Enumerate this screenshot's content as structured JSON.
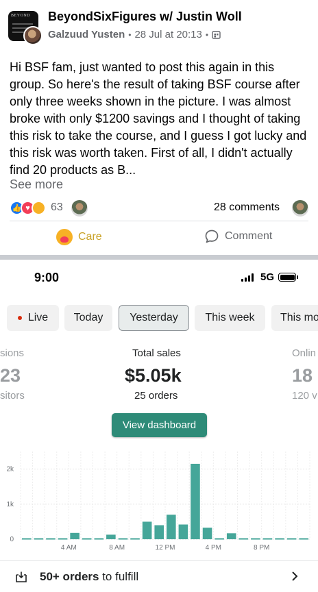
{
  "post": {
    "group_name": "BeyondSixFigures w/ Justin Woll",
    "author": "Galzuud Yusten",
    "date": "28 Jul at 20:13",
    "group_logo_text": "BEYOND",
    "body": "Hi BSF fam, just wanted to post this again in this group. So here's the result of taking BSF course after only three weeks shown in the picture. I was almost broke with only $1200 savings and I thought of taking this risk to take the course, and I guess I got lucky and this risk was worth taken. First of all, I didn't actually find 20 products as B...",
    "see_more": "See more",
    "reaction_count": "63",
    "comments": "28 comments",
    "actions": {
      "care": "Care",
      "comment": "Comment"
    },
    "icons": [
      "like-icon",
      "love-icon",
      "care-icon",
      "privacy-icon",
      "comment-icon"
    ]
  },
  "dashboard": {
    "status_time": "9:00",
    "network": "5G",
    "tabs": [
      "Live",
      "Today",
      "Yesterday",
      "This week",
      "This mo"
    ],
    "selected_tab": "Yesterday",
    "stats": {
      "left": {
        "label": "sions",
        "value": "23",
        "sub": "sitors"
      },
      "center": {
        "label": "Total sales",
        "value": "$5.05k",
        "sub": "25 orders"
      },
      "right": {
        "label": "Onlin",
        "value": "18",
        "sub": "120 v"
      }
    },
    "view_button": "View dashboard",
    "fulfill": {
      "count": "50+ orders",
      "suffix": " to fulfill"
    },
    "colors": {
      "accent": "#2e8b78",
      "bar": "#45a699",
      "live": "#d72c0d"
    }
  },
  "chart_data": {
    "type": "bar",
    "title": "",
    "xlabel": "",
    "ylabel": "",
    "ylim": [
      0,
      2500
    ],
    "yticks": [
      0,
      1000,
      2000
    ],
    "ytick_labels": [
      "0",
      "1k",
      "2k"
    ],
    "xtick_labels": [
      "4 AM",
      "8 AM",
      "12 PM",
      "4 PM",
      "8 PM"
    ],
    "xtick_hours": [
      4,
      8,
      12,
      16,
      20
    ],
    "hours": [
      0,
      1,
      2,
      3,
      4,
      5,
      6,
      7,
      8,
      9,
      10,
      11,
      12,
      13,
      14,
      15,
      16,
      17,
      18,
      19,
      20,
      21,
      22,
      23
    ],
    "values": [
      0,
      0,
      0,
      0,
      180,
      0,
      0,
      130,
      0,
      0,
      500,
      400,
      700,
      420,
      2150,
      330,
      0,
      170,
      0,
      0,
      0,
      0,
      0,
      0
    ]
  }
}
